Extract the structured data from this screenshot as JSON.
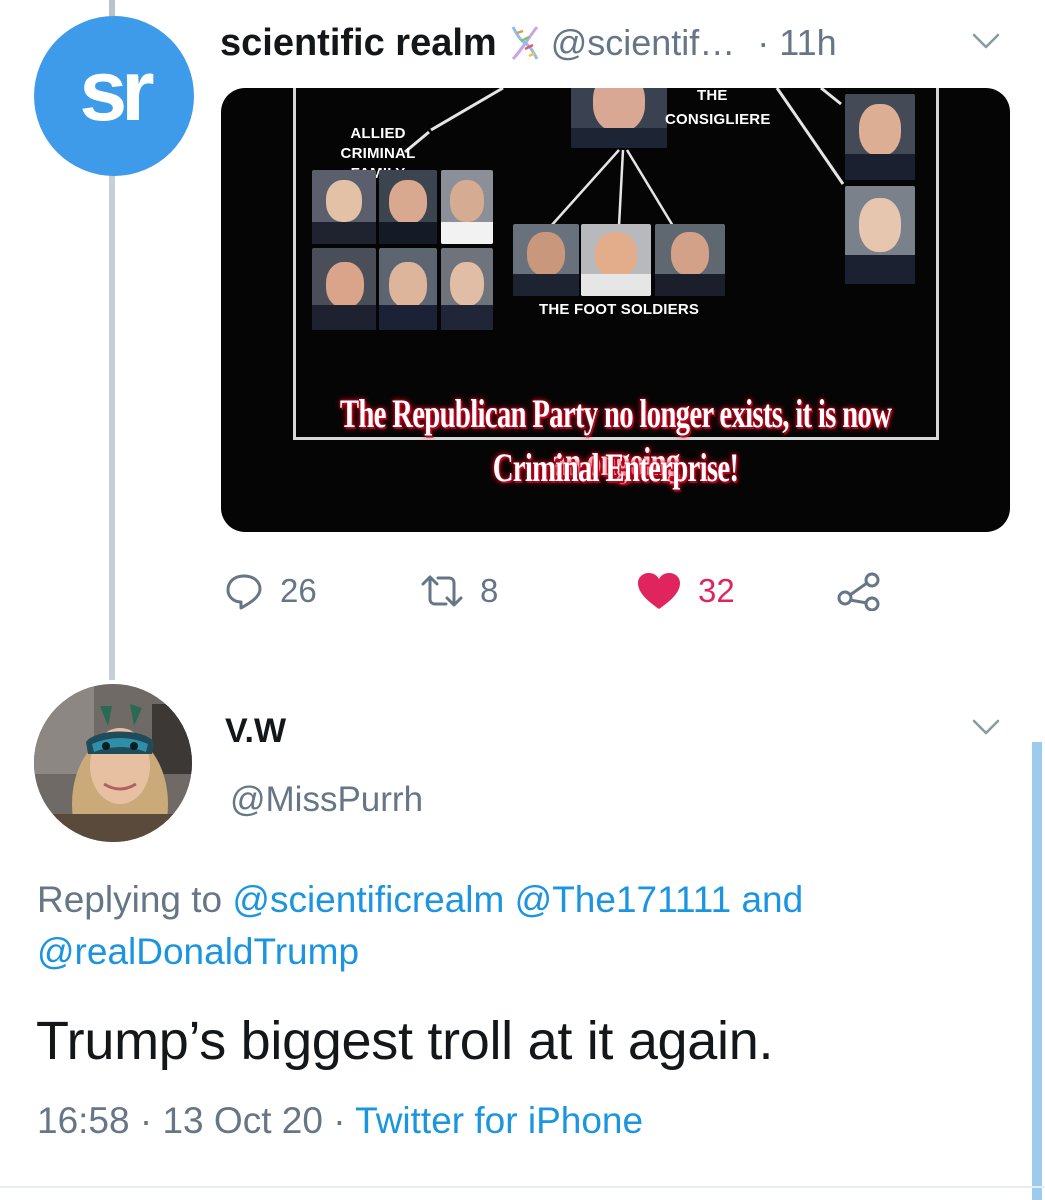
{
  "tweet": {
    "avatar_text": "sr",
    "display_name": "scientific realm",
    "verified_emoji_icon": "dna-icon",
    "handle": "@scientif…",
    "time": "· 11h",
    "media": {
      "labels": {
        "top_cut": "THE",
        "consigliere": "CONSIGLIERE",
        "allied_line1": "ALLIED CRIMINAL",
        "allied_line2": "FAMILY",
        "foot_soldiers": "THE FOOT SOLDIERS"
      },
      "caption_line1": "The Republican Party no longer exists, it is now an ongoing",
      "caption_line2": "Criminal Enterprise!"
    },
    "actions": {
      "replies": "26",
      "retweets": "8",
      "likes": "32"
    },
    "colors": {
      "like": "#e0245e",
      "muted": "#657786",
      "link": "#1b95e0",
      "avatar_bg": "#3d9be9"
    }
  },
  "reply": {
    "display_name": "V.W",
    "handle": "@MissPurrh",
    "replying_prefix": "Replying to",
    "mention1": "@scientificrealm",
    "mention2": "@The171111",
    "conjunction": "and",
    "mention3": "@realDonaldTrump",
    "text": "Trump’s biggest troll at it again.",
    "time": "16:58",
    "sep1": "·",
    "date": "13 Oct 20",
    "sep2": "·",
    "source": "Twitter for iPhone"
  }
}
